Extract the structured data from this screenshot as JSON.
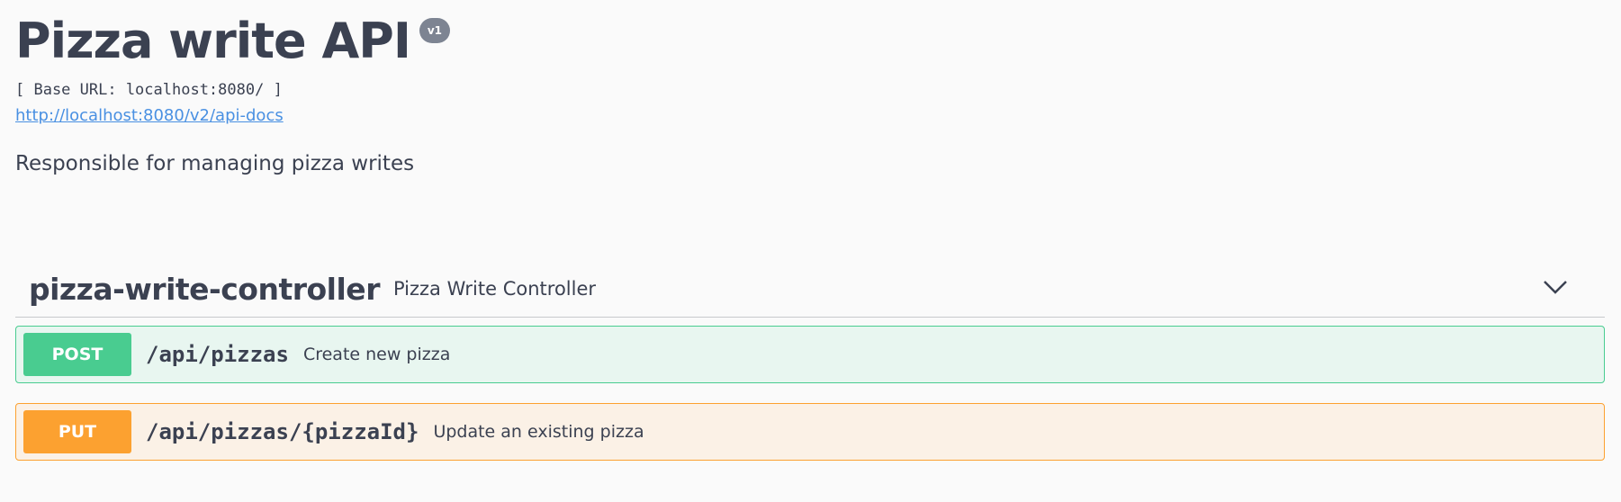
{
  "info": {
    "title": "Pizza write API",
    "version": "v1",
    "base_url": "[ Base URL: localhost:8080/ ]",
    "spec_link": "http://localhost:8080/v2/api-docs",
    "description": "Responsible for managing pizza writes"
  },
  "tag": {
    "name": "pizza-write-controller",
    "description": "Pizza Write Controller",
    "expand_icon": "chevron-down-icon"
  },
  "operations": [
    {
      "method": "POST",
      "path": "/api/pizzas",
      "summary": "Create new pizza",
      "color": "#49cc90"
    },
    {
      "method": "PUT",
      "path": "/api/pizzas/{pizzaId}",
      "summary": "Update an existing pizza",
      "color": "#fca130"
    }
  ]
}
